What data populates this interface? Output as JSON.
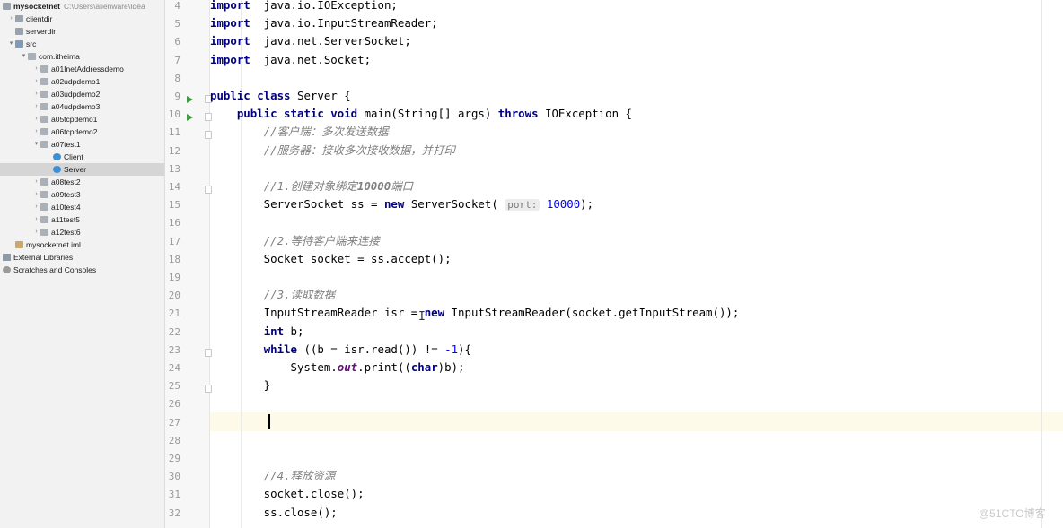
{
  "project_tree": [
    {
      "label": "mysocketnet",
      "hint": "C:\\Users\\alienware\\Idea",
      "depth": 0,
      "arrow": "open",
      "icon": "folder",
      "bold": true
    },
    {
      "label": "clientdir",
      "depth": 1,
      "arrow": "closed",
      "icon": "folder"
    },
    {
      "label": "serverdir",
      "depth": 1,
      "arrow": "none",
      "icon": "folder"
    },
    {
      "label": "src",
      "depth": 1,
      "arrow": "open",
      "icon": "folder-src"
    },
    {
      "label": "com.itheima",
      "depth": 2,
      "arrow": "open",
      "icon": "pkg"
    },
    {
      "label": "a01InetAddressdemo",
      "depth": 3,
      "arrow": "closed",
      "icon": "pkg"
    },
    {
      "label": "a02udpdemo1",
      "depth": 3,
      "arrow": "closed",
      "icon": "pkg"
    },
    {
      "label": "a03udpdemo2",
      "depth": 3,
      "arrow": "closed",
      "icon": "pkg"
    },
    {
      "label": "a04udpdemo3",
      "depth": 3,
      "arrow": "closed",
      "icon": "pkg"
    },
    {
      "label": "a05tcpdemo1",
      "depth": 3,
      "arrow": "closed",
      "icon": "pkg"
    },
    {
      "label": "a06tcpdemo2",
      "depth": 3,
      "arrow": "closed",
      "icon": "pkg"
    },
    {
      "label": "a07test1",
      "depth": 3,
      "arrow": "open",
      "icon": "pkg"
    },
    {
      "label": "Client",
      "depth": 4,
      "arrow": "none",
      "icon": "cls"
    },
    {
      "label": "Server",
      "depth": 4,
      "arrow": "none",
      "icon": "cls",
      "selected": true
    },
    {
      "label": "a08test2",
      "depth": 3,
      "arrow": "closed",
      "icon": "pkg"
    },
    {
      "label": "a09test3",
      "depth": 3,
      "arrow": "closed",
      "icon": "pkg"
    },
    {
      "label": "a10test4",
      "depth": 3,
      "arrow": "closed",
      "icon": "pkg"
    },
    {
      "label": "a11test5",
      "depth": 3,
      "arrow": "closed",
      "icon": "pkg"
    },
    {
      "label": "a12test6",
      "depth": 3,
      "arrow": "closed",
      "icon": "pkg"
    },
    {
      "label": "mysocketnet.iml",
      "depth": 1,
      "arrow": "none",
      "icon": "iml"
    },
    {
      "label": "External Libraries",
      "depth": 0,
      "arrow": "closed",
      "icon": "lib"
    },
    {
      "label": "Scratches and Consoles",
      "depth": 0,
      "arrow": "none",
      "icon": "scr"
    }
  ],
  "editor": {
    "caret_line": 27,
    "lines": [
      {
        "n": 4,
        "segs": [
          [
            "kw",
            "import"
          ],
          [
            "",
            "  java.io.IOException;"
          ]
        ]
      },
      {
        "n": 5,
        "segs": [
          [
            "kw",
            "import"
          ],
          [
            "",
            "  java.io.InputStreamReader;"
          ]
        ]
      },
      {
        "n": 6,
        "segs": [
          [
            "kw",
            "import"
          ],
          [
            "",
            "  java.net.ServerSocket;"
          ]
        ]
      },
      {
        "n": 7,
        "segs": [
          [
            "kw",
            "import"
          ],
          [
            "",
            "  java.net.Socket;"
          ]
        ]
      },
      {
        "n": 8,
        "segs": []
      },
      {
        "n": 9,
        "run": true,
        "fold": true,
        "segs": [
          [
            "kw",
            "public class"
          ],
          [
            "",
            " Server {"
          ]
        ]
      },
      {
        "n": 10,
        "run": true,
        "fold": true,
        "segs": [
          [
            "",
            "    "
          ],
          [
            "kw",
            "public static void"
          ],
          [
            "",
            " main(String[] args) "
          ],
          [
            "kw",
            "throws"
          ],
          [
            "",
            " IOException {"
          ]
        ]
      },
      {
        "n": 11,
        "fold": true,
        "segs": [
          [
            "",
            "        "
          ],
          [
            "cm",
            "//客户端：多次发送数据"
          ]
        ]
      },
      {
        "n": 12,
        "segs": [
          [
            "",
            "        "
          ],
          [
            "cm",
            "//服务器：接收多次接收数据，并打印"
          ]
        ]
      },
      {
        "n": 13,
        "segs": []
      },
      {
        "n": 14,
        "fold": true,
        "segs": [
          [
            "",
            "        "
          ],
          [
            "cm",
            "//1.创建对象绑定"
          ],
          [
            "cmb",
            "10000"
          ],
          [
            "cm",
            "端口"
          ]
        ]
      },
      {
        "n": 15,
        "segs": [
          [
            "",
            "        ServerSocket ss = "
          ],
          [
            "kw",
            "new"
          ],
          [
            "",
            " ServerSocket( "
          ],
          [
            "hint",
            "port:"
          ],
          [
            "",
            " "
          ],
          [
            "num",
            "10000"
          ],
          [
            "",
            ");"
          ]
        ]
      },
      {
        "n": 16,
        "segs": []
      },
      {
        "n": 17,
        "segs": [
          [
            "",
            "        "
          ],
          [
            "cm",
            "//2.等待客户端来连接"
          ]
        ]
      },
      {
        "n": 18,
        "segs": [
          [
            "",
            "        Socket socket = ss.accept();"
          ]
        ]
      },
      {
        "n": 19,
        "segs": []
      },
      {
        "n": 20,
        "segs": [
          [
            "",
            "        "
          ],
          [
            "cm",
            "//3.读取数据"
          ]
        ]
      },
      {
        "n": 21,
        "segs": [
          [
            "",
            "        InputStreamReader isr = "
          ],
          [
            "kw",
            "new"
          ],
          [
            "",
            " InputStreamReader(socket.getInputStream());"
          ]
        ]
      },
      {
        "n": 22,
        "segs": [
          [
            "",
            "        "
          ],
          [
            "kw",
            "int"
          ],
          [
            "",
            " b;"
          ]
        ]
      },
      {
        "n": 23,
        "fold": true,
        "segs": [
          [
            "",
            "        "
          ],
          [
            "kw",
            "while"
          ],
          [
            "",
            " ((b = isr.read()) != "
          ],
          [
            "num",
            "-1"
          ],
          [
            "",
            "){"
          ]
        ]
      },
      {
        "n": 24,
        "segs": [
          [
            "",
            "            System."
          ],
          [
            "st",
            "out"
          ],
          [
            "",
            ".print(("
          ],
          [
            "kw",
            "char"
          ],
          [
            "",
            ")b);"
          ]
        ]
      },
      {
        "n": 25,
        "fold": true,
        "segs": [
          [
            "",
            "        }"
          ]
        ]
      },
      {
        "n": 26,
        "segs": []
      },
      {
        "n": 27,
        "segs": []
      },
      {
        "n": 28,
        "segs": []
      },
      {
        "n": 29,
        "segs": []
      },
      {
        "n": 30,
        "segs": [
          [
            "",
            "        "
          ],
          [
            "cm",
            "//4.释放资源"
          ]
        ]
      },
      {
        "n": 31,
        "segs": [
          [
            "",
            "        socket.close();"
          ]
        ]
      },
      {
        "n": 32,
        "segs": [
          [
            "",
            "        ss.close();"
          ]
        ]
      }
    ]
  },
  "watermark": "@51CTO博客"
}
